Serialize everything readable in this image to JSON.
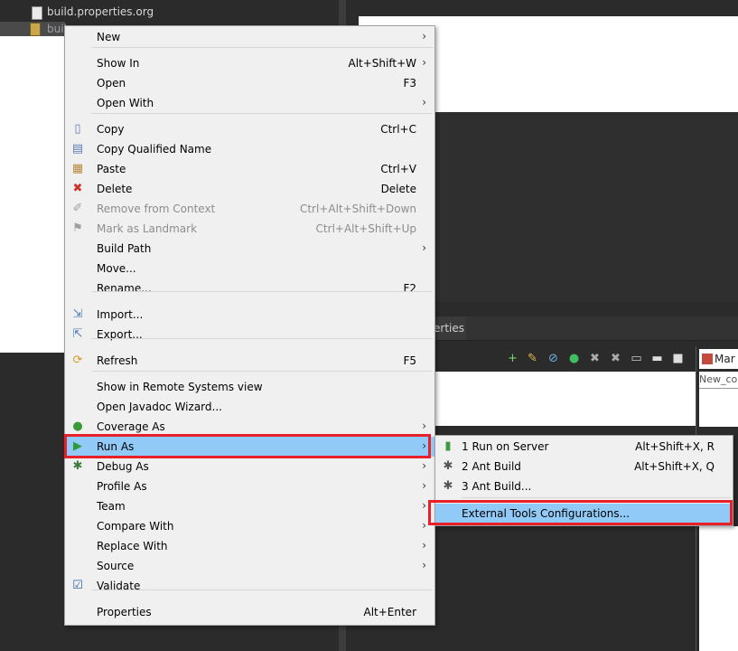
{
  "explorer": {
    "file1": "build.properties.org",
    "file2_partial": "buil"
  },
  "bottom": {
    "tab_label": "erties",
    "right_tab": "Mar",
    "right_field": "New_co"
  },
  "context_menu": {
    "items": [
      {
        "label": "New",
        "shortcut": "",
        "submenu": true,
        "icon": ""
      },
      {
        "label": "Show In",
        "shortcut": "Alt+Shift+W",
        "submenu": true,
        "icon": ""
      },
      {
        "label": "Open",
        "shortcut": "F3",
        "submenu": false,
        "icon": ""
      },
      {
        "label": "Open With",
        "shortcut": "",
        "submenu": true,
        "icon": ""
      },
      {
        "label": "Copy",
        "shortcut": "Ctrl+C",
        "submenu": false,
        "icon": "copy-icon"
      },
      {
        "label": "Copy Qualified Name",
        "shortcut": "",
        "submenu": false,
        "icon": "copy-qualified-icon"
      },
      {
        "label": "Paste",
        "shortcut": "Ctrl+V",
        "submenu": false,
        "icon": "paste-icon"
      },
      {
        "label": "Delete",
        "shortcut": "Delete",
        "submenu": false,
        "icon": "delete-icon"
      },
      {
        "label": "Remove from Context",
        "shortcut": "Ctrl+Alt+Shift+Down",
        "submenu": false,
        "icon": "remove-context-icon",
        "disabled": true
      },
      {
        "label": "Mark as Landmark",
        "shortcut": "Ctrl+Alt+Shift+Up",
        "submenu": false,
        "icon": "landmark-icon",
        "disabled": true
      },
      {
        "label": "Build Path",
        "shortcut": "",
        "submenu": true,
        "icon": ""
      },
      {
        "label": "Move...",
        "shortcut": "",
        "submenu": false,
        "icon": ""
      },
      {
        "label": "Rename...",
        "shortcut": "F2",
        "submenu": false,
        "icon": ""
      },
      {
        "label": "Import...",
        "shortcut": "",
        "submenu": false,
        "icon": "import-icon"
      },
      {
        "label": "Export...",
        "shortcut": "",
        "submenu": false,
        "icon": "export-icon"
      },
      {
        "label": "Refresh",
        "shortcut": "F5",
        "submenu": false,
        "icon": "refresh-icon"
      },
      {
        "label": "Show in Remote Systems view",
        "shortcut": "",
        "submenu": false,
        "icon": ""
      },
      {
        "label": "Open Javadoc Wizard...",
        "shortcut": "",
        "submenu": false,
        "icon": ""
      },
      {
        "label": "Coverage As",
        "shortcut": "",
        "submenu": true,
        "icon": "coverage-icon"
      },
      {
        "label": "Run As",
        "shortcut": "",
        "submenu": true,
        "icon": "run-icon",
        "highlighted": true
      },
      {
        "label": "Debug As",
        "shortcut": "",
        "submenu": true,
        "icon": "debug-icon"
      },
      {
        "label": "Profile As",
        "shortcut": "",
        "submenu": true,
        "icon": ""
      },
      {
        "label": "Team",
        "shortcut": "",
        "submenu": true,
        "icon": ""
      },
      {
        "label": "Compare With",
        "shortcut": "",
        "submenu": true,
        "icon": ""
      },
      {
        "label": "Replace With",
        "shortcut": "",
        "submenu": true,
        "icon": ""
      },
      {
        "label": "Source",
        "shortcut": "",
        "submenu": true,
        "icon": ""
      },
      {
        "label": "Validate",
        "shortcut": "",
        "submenu": false,
        "icon": "checkbox-checked-icon"
      },
      {
        "label": "Properties",
        "shortcut": "Alt+Enter",
        "submenu": false,
        "icon": ""
      }
    ]
  },
  "run_as_submenu": {
    "items": [
      {
        "label": "1 Run on Server",
        "shortcut": "Alt+Shift+X, R",
        "icon": "server-icon"
      },
      {
        "label": "2 Ant Build",
        "shortcut": "Alt+Shift+X, Q",
        "icon": "ant-icon"
      },
      {
        "label": "3 Ant Build...",
        "shortcut": "",
        "icon": "ant-icon"
      },
      {
        "label": "External Tools Configurations...",
        "shortcut": "",
        "icon": "",
        "highlighted": true
      }
    ]
  },
  "colors": {
    "highlight": "#91c9f7",
    "annotation_red": "#e8202a",
    "menu_bg": "#f0f0f0",
    "ide_dark": "#2b2b2b"
  }
}
